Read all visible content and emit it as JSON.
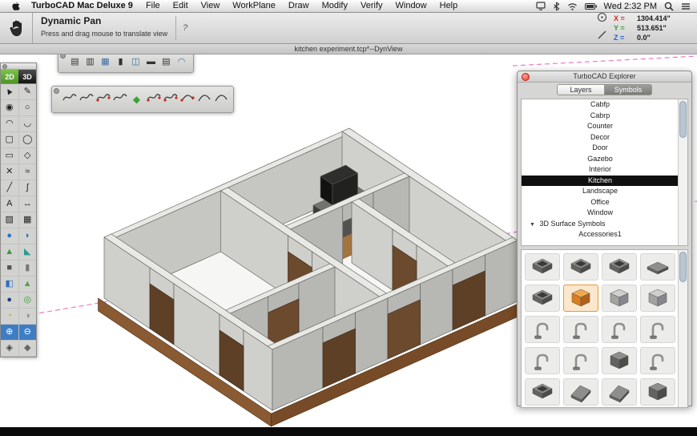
{
  "menu_bar": {
    "items": [
      "TurboCAD Mac Deluxe 9",
      "File",
      "Edit",
      "View",
      "WorkPlane",
      "Draw",
      "Modify",
      "Verify",
      "Window",
      "Help"
    ],
    "clock": "Wed 2:32 PM"
  },
  "toolbar": {
    "tool_name": "Dynamic Pan",
    "tool_hint": "Press and drag mouse to translate view",
    "help": "?",
    "coords": [
      {
        "axis": "X",
        "value": "1304.414\"",
        "color": "#cc2a1f"
      },
      {
        "axis": "Y",
        "value": "513.651\"",
        "color": "#3a9a35"
      },
      {
        "axis": "Z",
        "value": "0.0\"",
        "color": "#2a63c9"
      }
    ]
  },
  "document": {
    "title": "kitchen experiment.tcp*--DynView"
  },
  "tool_palette": {
    "mode_2d": "2D",
    "mode_3d": "3D",
    "rows": [
      {
        "l": {
          "name": "select-tool",
          "glyph": "▲",
          "rot": true
        },
        "r": {
          "name": "pen-tool",
          "glyph": "✎"
        }
      },
      {
        "l": {
          "name": "circle-center-tool",
          "glyph": "◉"
        },
        "r": {
          "name": "circle-tool",
          "glyph": "○"
        }
      },
      {
        "l": {
          "name": "arc-tool",
          "glyph": "◠"
        },
        "r": {
          "name": "arc-end-tool",
          "glyph": "◡"
        }
      },
      {
        "l": {
          "name": "rounded-rect-tool",
          "glyph": "▢"
        },
        "r": {
          "name": "ellipse-tool",
          "glyph": "◯"
        }
      },
      {
        "l": {
          "name": "rect-tool",
          "glyph": "▭"
        },
        "r": {
          "name": "polygon-tool",
          "glyph": "◇"
        }
      },
      {
        "l": {
          "name": "erase-tool",
          "glyph": "✕"
        },
        "r": {
          "name": "freehand-tool",
          "glyph": "≈"
        }
      },
      {
        "l": {
          "name": "line-tool",
          "glyph": "╱"
        },
        "r": {
          "name": "polyline-tool",
          "glyph": "∫"
        }
      },
      {
        "l": {
          "name": "text-tool",
          "glyph": "A"
        },
        "r": {
          "name": "dimension-tool",
          "glyph": "↔"
        }
      },
      {
        "l": {
          "name": "hatch-tool",
          "glyph": "▨"
        },
        "r": {
          "name": "fill-tool",
          "glyph": "▦"
        }
      },
      {
        "l": {
          "name": "sphere-tool",
          "glyph": "●",
          "color": "#2f6fc2"
        },
        "r": {
          "name": "hemisphere-tool",
          "glyph": "◗",
          "color": "#2f6fc2"
        }
      },
      {
        "l": {
          "name": "prism-tool",
          "glyph": "▲",
          "color": "#3d9a36"
        },
        "r": {
          "name": "wedge-tool",
          "glyph": "◣",
          "color": "#2a9a8f"
        }
      },
      {
        "l": {
          "name": "box-tool",
          "glyph": "■",
          "color": "#555555"
        },
        "r": {
          "name": "cylinder-tool",
          "glyph": "▮",
          "color": "#777777"
        }
      },
      {
        "l": {
          "name": "extrude-tool",
          "glyph": "◧",
          "color": "#2f6fc2"
        },
        "r": {
          "name": "cone-tool",
          "glyph": "▲",
          "color": "#56a046"
        }
      },
      {
        "l": {
          "name": "sphere-dark-tool",
          "glyph": "●",
          "color": "#1d3f7a"
        },
        "r": {
          "name": "torus-tool",
          "glyph": "◎",
          "color": "#3d9a36"
        }
      },
      {
        "l": {
          "name": "revolve-tool",
          "glyph": "◔",
          "color": "#d6a021"
        },
        "r": {
          "name": "sweep-tool",
          "glyph": "◑",
          "color": "#888888"
        }
      },
      {
        "active": true,
        "l": {
          "name": "zoom-in-tool",
          "glyph": "⊕"
        },
        "r": {
          "name": "zoom-out-tool",
          "glyph": "⊖"
        }
      },
      {
        "l": {
          "name": "iso-view-tool",
          "glyph": "◈",
          "color": "#444444"
        },
        "r": {
          "name": "cube-view-tool",
          "glyph": "◆",
          "color": "#666666"
        }
      }
    ]
  },
  "arch_toolbar": {
    "buttons": [
      {
        "name": "wall-tool",
        "glyph": "▤"
      },
      {
        "name": "window-tool",
        "glyph": "▥"
      },
      {
        "name": "window-grid-tool",
        "glyph": "▦",
        "color": "#3a6ea5"
      },
      {
        "name": "column-tool",
        "glyph": "▮"
      },
      {
        "name": "door-tool",
        "glyph": "◫",
        "color": "#3a6ea5"
      },
      {
        "name": "slab-tool",
        "glyph": "▬"
      },
      {
        "name": "stair-tool",
        "glyph": "▤"
      },
      {
        "name": "roof-tool",
        "glyph": "◠",
        "color": "#3a6ea5"
      }
    ]
  },
  "spline_toolbar": {
    "buttons": [
      {
        "name": "spline-tool",
        "type": "squiggle"
      },
      {
        "name": "bezier-tool",
        "type": "squiggle"
      },
      {
        "name": "spline-by-points-tool",
        "type": "squiggle",
        "red": true
      },
      {
        "name": "closed-spline-tool",
        "type": "squiggle"
      },
      {
        "name": "convert-curve-tool",
        "type": "diamond"
      },
      {
        "name": "edit-spline-tool",
        "type": "squiggle",
        "red": true
      },
      {
        "name": "curve-handles-tool",
        "type": "squiggle",
        "red": true
      },
      {
        "name": "arc-curve-tool",
        "type": "arc",
        "red": true
      },
      {
        "name": "smooth-curve-tool",
        "type": "arc"
      },
      {
        "name": "curve-length-tool",
        "type": "arc"
      }
    ]
  },
  "explorer": {
    "title": "TurboCAD Explorer",
    "tabs": [
      {
        "label": "Layers",
        "active": false
      },
      {
        "label": "Symbols",
        "active": true
      }
    ],
    "categories": [
      "Cabfp",
      "Cabrp",
      "Counter",
      "Decor",
      "Door",
      "Gazebo",
      "Interior",
      "Kitchen",
      "Landscape",
      "Office",
      "Window"
    ],
    "selected_category": "Kitchen",
    "section": {
      "label": "3D Surface Symbols",
      "children": [
        "Accessories1"
      ]
    },
    "symbols": {
      "selected_index": 5,
      "items": [
        {
          "name": "sink-grate",
          "kind": "sink",
          "c": "d"
        },
        {
          "name": "sink-double",
          "kind": "sink",
          "c": "d"
        },
        {
          "name": "sink-grate-2",
          "kind": "sink",
          "c": "d"
        },
        {
          "name": "sink-flat",
          "kind": "flat",
          "c": "d"
        },
        {
          "name": "sink-basin",
          "kind": "sink",
          "c": "d"
        },
        {
          "name": "base-cabinet",
          "kind": "cube",
          "c": "o"
        },
        {
          "name": "cabinet-tall",
          "kind": "cube",
          "c": "g"
        },
        {
          "name": "cabinet-hamper",
          "kind": "cube",
          "c": "g"
        },
        {
          "name": "faucet-arc",
          "kind": "faucet",
          "c": "m"
        },
        {
          "name": "faucet-single",
          "kind": "faucet",
          "c": "m"
        },
        {
          "name": "faucet-pair",
          "kind": "faucet",
          "c": "m"
        },
        {
          "name": "faucet-lever",
          "kind": "faucet",
          "c": "m"
        },
        {
          "name": "faucet-tall",
          "kind": "faucet",
          "c": "m"
        },
        {
          "name": "faucet-spray",
          "kind": "faucet",
          "c": "m"
        },
        {
          "name": "trash-compactor",
          "kind": "cube",
          "c": "d"
        },
        {
          "name": "faucet-wall",
          "kind": "faucet",
          "c": "m"
        },
        {
          "name": "sink-corner",
          "kind": "sink",
          "c": "d"
        },
        {
          "name": "hood-wedge",
          "kind": "wedge",
          "c": "d"
        },
        {
          "name": "hood-low",
          "kind": "wedge",
          "c": "d"
        },
        {
          "name": "sink-block",
          "kind": "cube",
          "c": "d"
        }
      ]
    }
  },
  "colors": {
    "accent_blue": "#3e7dc4",
    "selection_orange": "#e8973a",
    "construction_pink": "#f078c8",
    "wall_gray": "#cfcfcc",
    "floor_brown": "#8a5a33"
  }
}
